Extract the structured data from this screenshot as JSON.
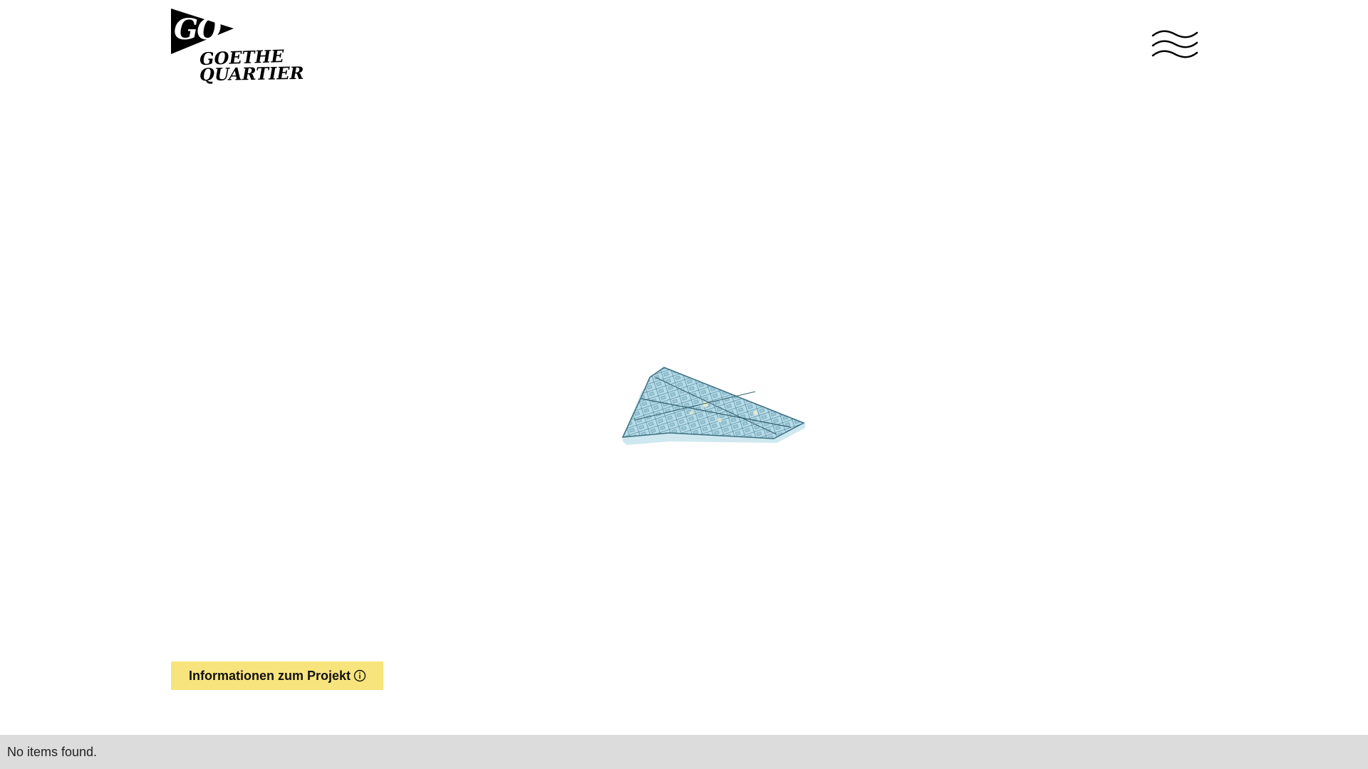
{
  "header": {
    "logo": {
      "mark_text": "GO",
      "line1": "GOETHE",
      "line2": "QUARTIER"
    },
    "menu": {
      "icon": "wavy-menu-icon"
    }
  },
  "main": {
    "map": {
      "icon": "district-3d-map"
    },
    "info_button": {
      "label": "Informationen zum Projekt",
      "icon": "info-circle-icon",
      "color": "#f8e47c"
    }
  },
  "status": {
    "text": "No items found."
  },
  "colors": {
    "background": "#ffffff",
    "accent_yellow": "#f8e47c",
    "map_blue": "#a9d3e2",
    "status_bar": "#dcdcdc"
  }
}
